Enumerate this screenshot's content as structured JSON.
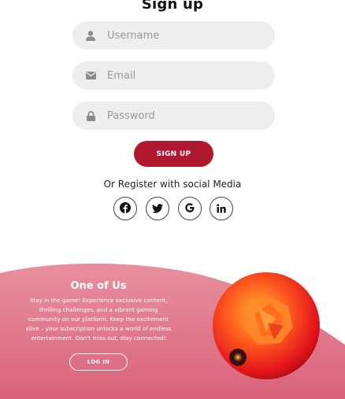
{
  "form": {
    "title": "Sign up",
    "username_placeholder": "Username",
    "email_placeholder": "Email",
    "password_placeholder": "Password",
    "submit_label": "SIGN UP",
    "social_text": "Or Register with social Media",
    "social_icons": [
      "facebook-icon",
      "twitter-icon",
      "google-icon",
      "linkedin-icon"
    ]
  },
  "promo": {
    "title": "One of Us",
    "body": "Stay in the game! Experience exclusive content, thrilling challenges, and a vibrant gaming community on our platform. Keep the excitement alive – your subscription unlocks a world of endless entertainment. Don't miss out, stay connected!",
    "login_label": "LOG IN"
  },
  "colors": {
    "accent": "#b0182f",
    "wave_top": "#e8909e",
    "wave_bottom": "#d9637a",
    "field_bg": "#eeeeee"
  }
}
